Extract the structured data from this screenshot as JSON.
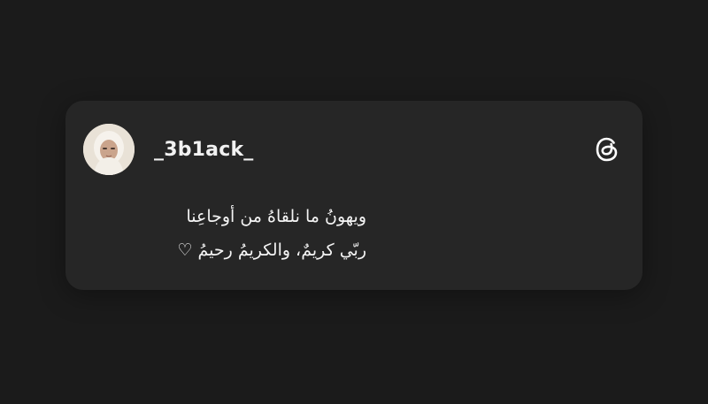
{
  "post": {
    "username": "_3b1ack_",
    "lines": [
      "ويهونُ ما نلقاهُ من أوجاعِنا",
      "ربّي كريمٌ، والكريمُ رحيمُ ♡"
    ]
  },
  "icons": {
    "avatar": "profile-photo",
    "brand": "threads-logo-icon"
  },
  "colors": {
    "background": "#1b1b1b",
    "card": "#262626",
    "text": "#f4f4f4"
  }
}
